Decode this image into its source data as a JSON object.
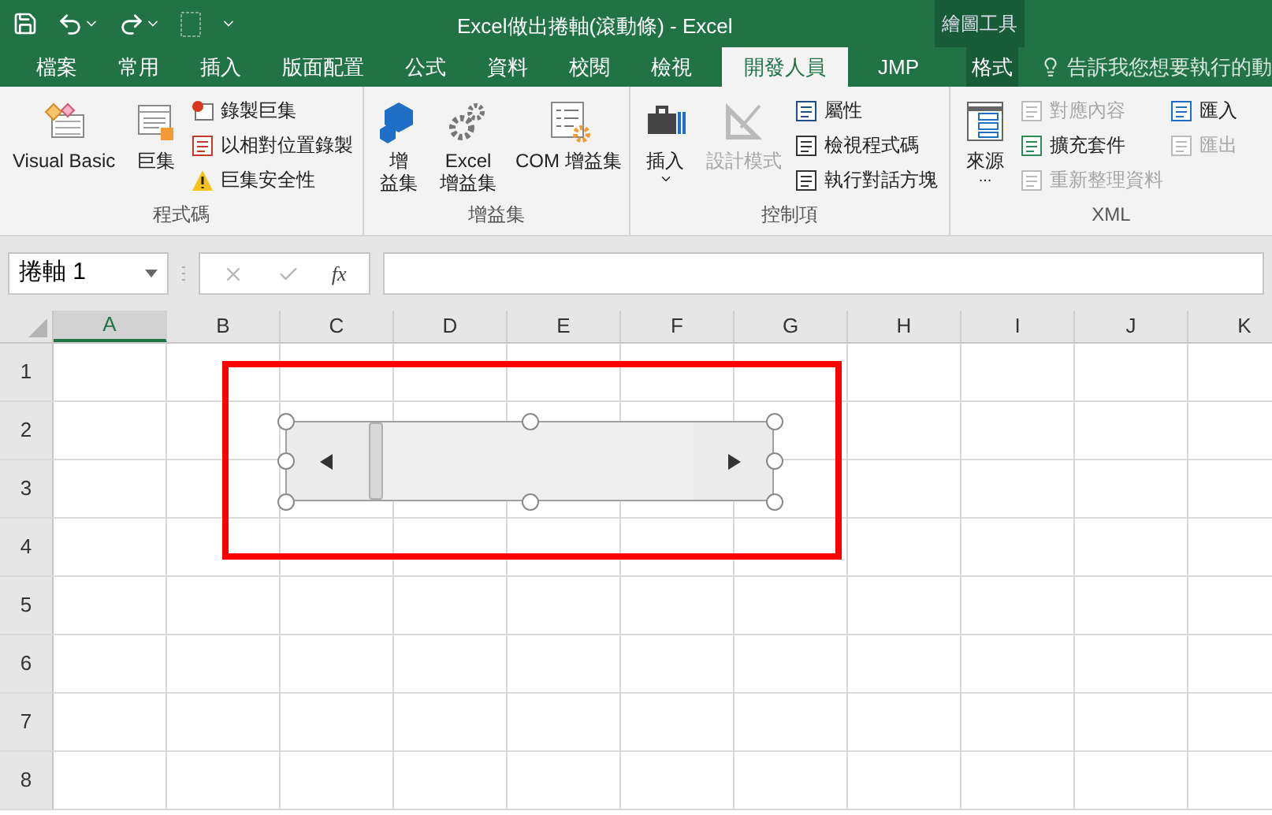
{
  "window": {
    "title": "Excel做出捲軸(滾動條) - Excel",
    "context_group": "繪圖工具"
  },
  "tabs": [
    {
      "label": "檔案",
      "selected": false,
      "kind": "normal"
    },
    {
      "label": "常用",
      "selected": false,
      "kind": "normal"
    },
    {
      "label": "插入",
      "selected": false,
      "kind": "normal"
    },
    {
      "label": "版面配置",
      "selected": false,
      "kind": "normal"
    },
    {
      "label": "公式",
      "selected": false,
      "kind": "normal"
    },
    {
      "label": "資料",
      "selected": false,
      "kind": "normal"
    },
    {
      "label": "校閱",
      "selected": false,
      "kind": "normal"
    },
    {
      "label": "檢視",
      "selected": false,
      "kind": "normal"
    },
    {
      "label": "開發人員",
      "selected": true,
      "kind": "normal"
    },
    {
      "label": "JMP",
      "selected": false,
      "kind": "normal"
    },
    {
      "label": "格式",
      "selected": false,
      "kind": "contextual"
    }
  ],
  "tell_me": {
    "placeholder": "告訴我您想要執行的動"
  },
  "ribbon": {
    "groups": [
      {
        "label": "程式碼",
        "items": [
          {
            "label": "Visual Basic",
            "disabled": false
          },
          {
            "label": "巨集",
            "disabled": false
          },
          {
            "label": "錄製巨集",
            "disabled": false
          },
          {
            "label": "以相對位置錄製",
            "disabled": false
          },
          {
            "label": "巨集安全性",
            "disabled": false
          }
        ]
      },
      {
        "label": "增益集",
        "items": [
          {
            "lines": [
              "增",
              "益集"
            ],
            "disabled": false
          },
          {
            "lines": [
              "Excel",
              "增益集"
            ],
            "disabled": false
          },
          {
            "label": "COM 增益集",
            "disabled": false
          }
        ]
      },
      {
        "label": "控制項",
        "items": [
          {
            "label": "插入",
            "disabled": false
          },
          {
            "label": "設計模式",
            "disabled": true
          },
          {
            "label": "屬性",
            "disabled": false
          },
          {
            "label": "檢視程式碼",
            "disabled": false
          },
          {
            "label": "執行對話方塊",
            "disabled": false
          }
        ]
      },
      {
        "label": "XML",
        "items": [
          {
            "label": "來源",
            "sub": "...",
            "disabled": false
          },
          {
            "label": "對應內容",
            "disabled": true
          },
          {
            "label": "擴充套件",
            "disabled": false
          },
          {
            "label": "重新整理資料",
            "disabled": true
          },
          {
            "label": "匯入",
            "disabled": false
          },
          {
            "label": "匯出",
            "disabled": true
          }
        ]
      }
    ]
  },
  "formula_bar": {
    "name_box": "捲軸 1",
    "function_label": "fx"
  },
  "columns": [
    {
      "label": "A",
      "selected": true
    },
    {
      "label": "B",
      "selected": false
    },
    {
      "label": "C",
      "selected": false
    },
    {
      "label": "D",
      "selected": false
    },
    {
      "label": "E",
      "selected": false
    },
    {
      "label": "F",
      "selected": false
    },
    {
      "label": "G",
      "selected": false
    },
    {
      "label": "H",
      "selected": false
    },
    {
      "label": "I",
      "selected": false
    },
    {
      "label": "J",
      "selected": false
    },
    {
      "label": "K",
      "selected": false
    }
  ],
  "rows": [
    "1",
    "2",
    "3",
    "4",
    "5",
    "6",
    "7",
    "8"
  ],
  "scrollbar": {
    "level": 0,
    "selected": true
  },
  "highlight": {
    "color": "#ff0000"
  }
}
